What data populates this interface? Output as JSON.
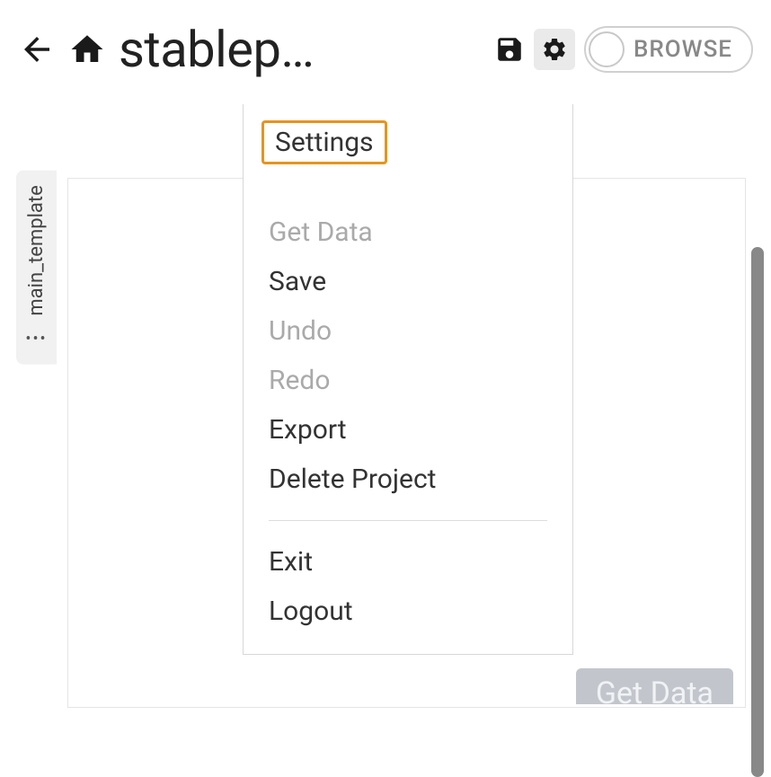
{
  "toolbar": {
    "project_title": "stablep…",
    "browse_label": "BROWSE"
  },
  "side_tab": {
    "label": "main_template"
  },
  "menu": {
    "settings": "Settings",
    "get_data": "Get Data",
    "save": "Save",
    "undo": "Undo",
    "redo": "Redo",
    "export": "Export",
    "delete_project": "Delete Project",
    "exit": "Exit",
    "logout": "Logout"
  },
  "ghost_button": {
    "label": "Get Data"
  }
}
